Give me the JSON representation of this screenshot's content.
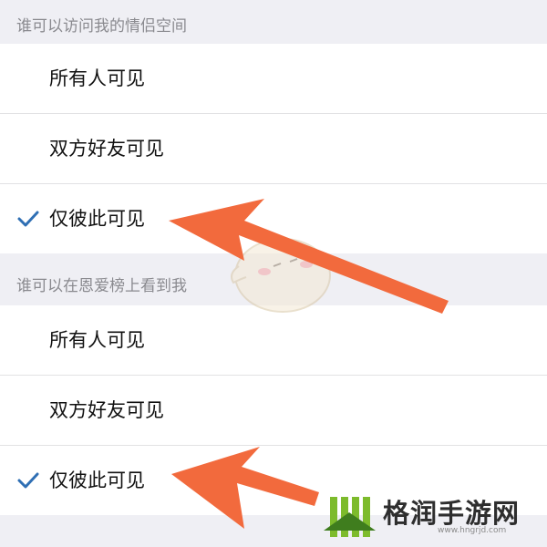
{
  "sections": [
    {
      "header": "谁可以访问我的情侣空间",
      "options": [
        {
          "label": "所有人可见",
          "selected": false
        },
        {
          "label": "双方好友可见",
          "selected": false
        },
        {
          "label": "仅彼此可见",
          "selected": true
        }
      ]
    },
    {
      "header": "谁可以在恩爱榜上看到我",
      "options": [
        {
          "label": "所有人可见",
          "selected": false
        },
        {
          "label": "双方好友可见",
          "selected": false
        },
        {
          "label": "仅彼此可见",
          "selected": true
        }
      ]
    }
  ],
  "watermark": {
    "site_name": "格润手游网",
    "url": "www.hngrjd.com"
  },
  "colors": {
    "check": "#2f6fb4",
    "annotation_arrow": "#f26a3d",
    "section_bg": "#efeff4"
  },
  "icons": [
    "check-icon",
    "arrow-annotation-icon",
    "mascot-watermark-icon",
    "site-logo-icon"
  ]
}
